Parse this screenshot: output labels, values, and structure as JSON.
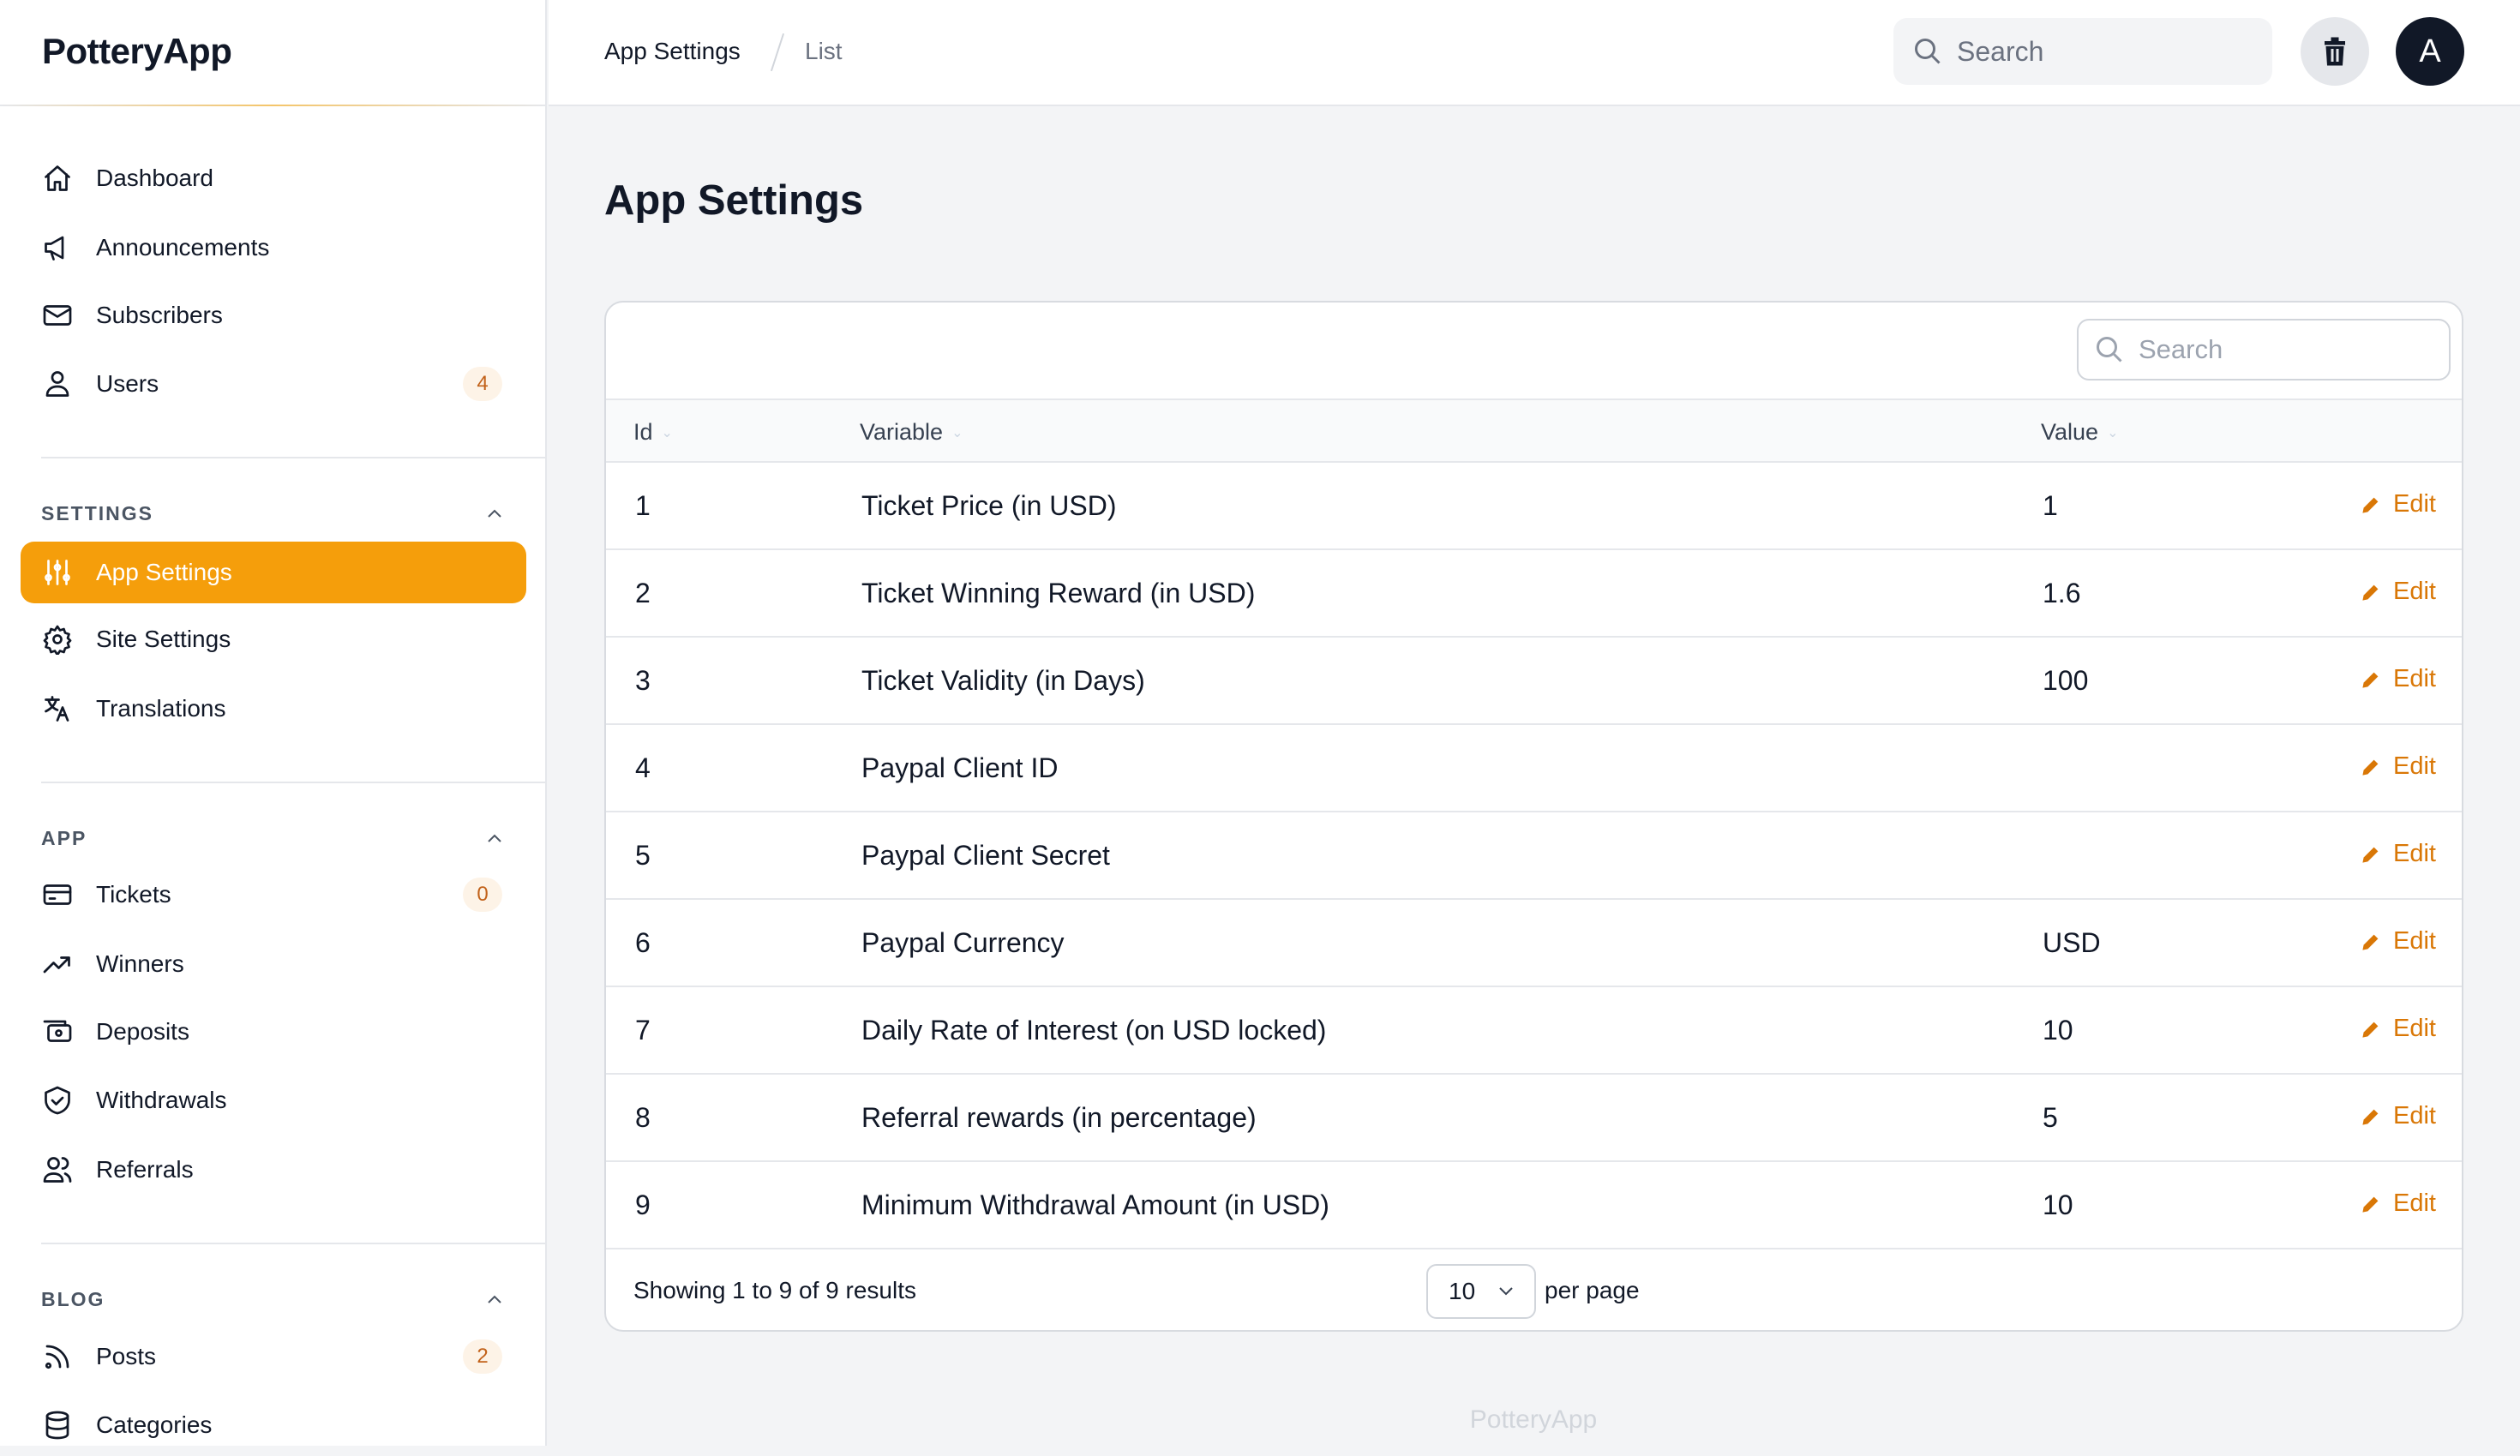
{
  "app": {
    "name": "PotteryApp",
    "footer": "PotteryApp"
  },
  "colors": {
    "accent": "#f59e0b",
    "edit": "#d97706",
    "avatar": "#111827"
  },
  "sidebar": {
    "main": [
      {
        "label": "Dashboard",
        "icon": "home-icon"
      },
      {
        "label": "Announcements",
        "icon": "megaphone-icon"
      },
      {
        "label": "Subscribers",
        "icon": "mail-icon"
      },
      {
        "label": "Users",
        "icon": "user-icon",
        "badge": "4"
      }
    ],
    "settings": {
      "title": "SETTINGS",
      "items": [
        {
          "label": "App Settings",
          "icon": "sliders-icon",
          "active": true
        },
        {
          "label": "Site Settings",
          "icon": "gear-icon"
        },
        {
          "label": "Translations",
          "icon": "translate-icon"
        }
      ]
    },
    "app": {
      "title": "APP",
      "items": [
        {
          "label": "Tickets",
          "icon": "ticket-icon",
          "badge": "0"
        },
        {
          "label": "Winners",
          "icon": "trending-up-icon"
        },
        {
          "label": "Deposits",
          "icon": "cash-icon"
        },
        {
          "label": "Withdrawals",
          "icon": "shield-icon"
        },
        {
          "label": "Referrals",
          "icon": "users-icon"
        }
      ]
    },
    "blog": {
      "title": "BLOG",
      "items": [
        {
          "label": "Posts",
          "icon": "rss-icon",
          "badge": "2"
        },
        {
          "label": "Categories",
          "icon": "database-icon"
        }
      ]
    }
  },
  "header": {
    "breadcrumb": [
      "App Settings",
      "List"
    ],
    "search_placeholder": "Search",
    "avatar": "A"
  },
  "page": {
    "title": "App Settings"
  },
  "table": {
    "search_placeholder": "Search",
    "columns": [
      "Id",
      "Variable",
      "Value"
    ],
    "edit_label": "Edit",
    "rows": [
      {
        "id": "1",
        "variable": "Ticket Price (in USD)",
        "value": "1"
      },
      {
        "id": "2",
        "variable": "Ticket Winning Reward (in USD)",
        "value": "1.6"
      },
      {
        "id": "3",
        "variable": "Ticket Validity (in Days)",
        "value": "100"
      },
      {
        "id": "4",
        "variable": "Paypal Client ID",
        "value": ""
      },
      {
        "id": "5",
        "variable": "Paypal Client Secret",
        "value": ""
      },
      {
        "id": "6",
        "variable": "Paypal Currency",
        "value": "USD"
      },
      {
        "id": "7",
        "variable": "Daily Rate of Interest (on USD locked)",
        "value": "10"
      },
      {
        "id": "8",
        "variable": "Referral rewards (in percentage)",
        "value": "5"
      },
      {
        "id": "9",
        "variable": "Minimum Withdrawal Amount (in USD)",
        "value": "10"
      }
    ],
    "summary": "Showing 1 to 9 of 9 results",
    "per_page_value": "10",
    "per_page_label": "per page"
  }
}
